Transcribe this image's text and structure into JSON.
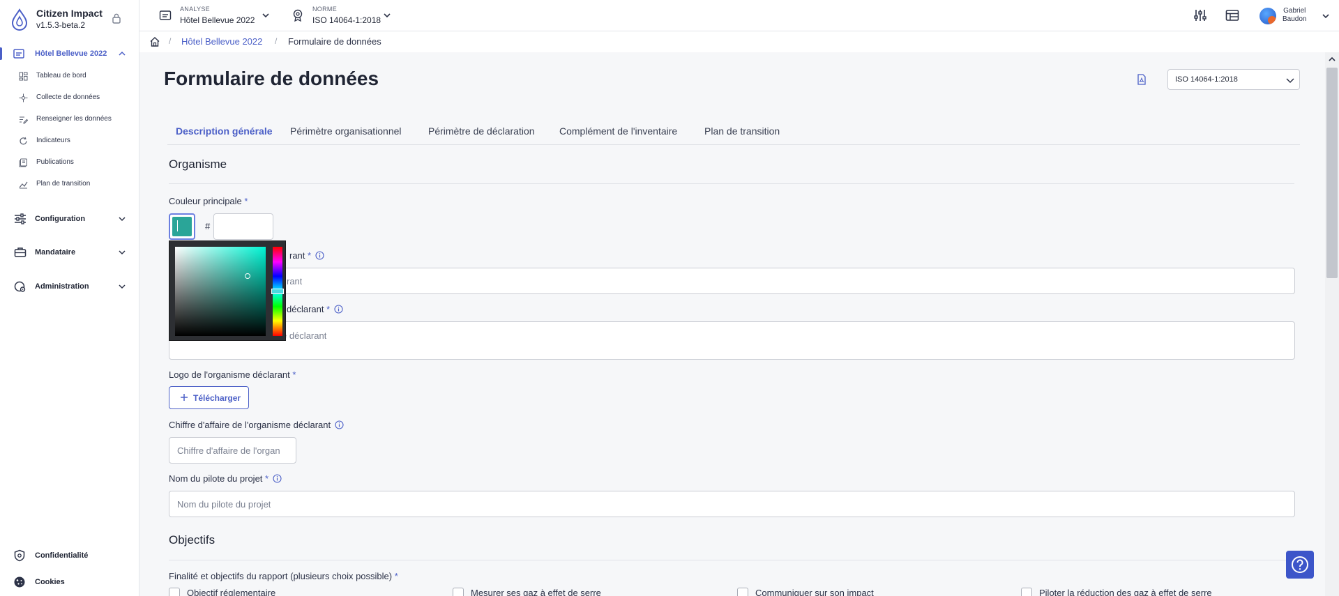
{
  "brand": {
    "name": "Citizen Impact",
    "version": "v1.5.3-beta.2"
  },
  "sidebar": {
    "project": "Hôtel Bellevue 2022",
    "project_items": [
      {
        "label": "Tableau de bord",
        "icon": "dashboard-icon"
      },
      {
        "label": "Collecte de données",
        "icon": "collect-icon"
      },
      {
        "label": "Renseigner les données",
        "icon": "edit-list-icon"
      },
      {
        "label": "Indicateurs",
        "icon": "refresh-icon"
      },
      {
        "label": "Publications",
        "icon": "publications-icon"
      },
      {
        "label": "Plan de transition",
        "icon": "trend-icon"
      }
    ],
    "groups": [
      {
        "label": "Configuration",
        "icon": "sliders-icon"
      },
      {
        "label": "Mandataire",
        "icon": "briefcase-icon"
      },
      {
        "label": "Administration",
        "icon": "admin-icon"
      }
    ],
    "bottom": [
      {
        "label": "Confidentialité",
        "icon": "shield-icon"
      },
      {
        "label": "Cookies",
        "icon": "cookie-icon"
      }
    ]
  },
  "topbar": {
    "analysis_caption": "ANALYSE",
    "analysis_value": "Hôtel Bellevue 2022",
    "norm_caption": "NORME",
    "norm_value": "ISO 14064-1:2018",
    "user_first": "Gabriel",
    "user_last": "Baudon"
  },
  "breadcrumb": {
    "items": [
      "Hôtel Bellevue 2022",
      "Formulaire de données"
    ],
    "separator": "/"
  },
  "page": {
    "title": "Formulaire de données",
    "norm_select": "ISO 14064-1:2018",
    "tabs": [
      "Description générale",
      "Périmètre organisationnel",
      "Périmètre de déclaration",
      "Complément de l'inventaire",
      "Plan de transition"
    ]
  },
  "form": {
    "section_org": "Organisme",
    "color_label": "Couleur principale",
    "required_mark": "*",
    "hash": "#",
    "name_label_visible": "rant",
    "name_placeholder_visible": "rant",
    "address_label_visible": "déclarant",
    "address_placeholder_visible": "e déclarant",
    "logo_label": "Logo de l'organisme déclarant",
    "upload_label": "Télécharger",
    "revenue_label": "Chiffre d'affaire de l'organisme déclarant",
    "revenue_placeholder": "Chiffre d'affaire de l'organ",
    "pilot_label": "Nom du pilote du projet",
    "pilot_placeholder": "Nom du pilote du projet",
    "section_goals": "Objectifs",
    "goals_label": "Finalité et objectifs du rapport (plusieurs choix possible)",
    "goals_options": [
      "Objectif réglementaire",
      "Mesurer ses gaz à effet de serre",
      "Communiquer sur son impact",
      "Piloter la réduction des gaz à effet de serre"
    ]
  },
  "colors": {
    "accent": "#4b5fc7",
    "swatch": "#2aa598",
    "help": "#3c55c9"
  }
}
